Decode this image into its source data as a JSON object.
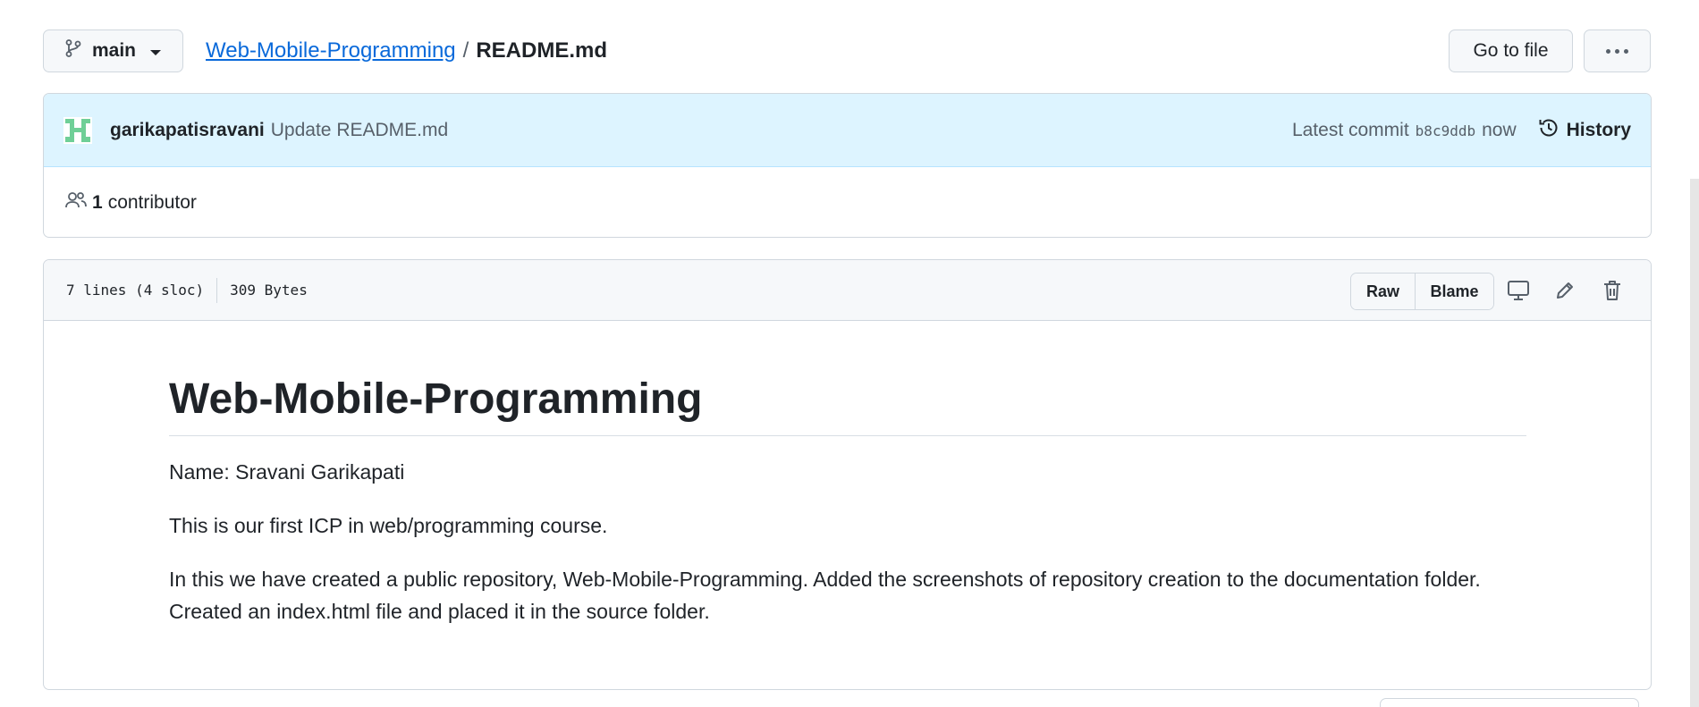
{
  "toolbar": {
    "branch_label": "main",
    "repo_link": "Web-Mobile-Programming",
    "separator": "/",
    "file_name": "README.md",
    "go_to_file": "Go to file"
  },
  "commit": {
    "author": "garikapatisravani",
    "message": "Update README.md",
    "latest_label": "Latest commit",
    "sha": "b8c9ddb",
    "time": "now",
    "history_label": "History"
  },
  "contributors": {
    "count": "1",
    "label": "contributor"
  },
  "file_info": {
    "lines": "7 lines (4 sloc)",
    "size": "309 Bytes",
    "raw_label": "Raw",
    "blame_label": "Blame"
  },
  "readme": {
    "heading": "Web-Mobile-Programming",
    "paragraphs": [
      "Name: Sravani Garikapati",
      "This is our first ICP in web/programming course.",
      "In this we have created a public repository, Web-Mobile-Programming. Added the screenshots of repository creation to the documentation folder. Created an index.html file and placed it in the source folder."
    ]
  },
  "icons": {
    "branch": "git-branch-icon",
    "caret": "chevron-down-icon",
    "more": "kebab-horizontal-icon",
    "history": "history-icon",
    "people": "people-icon",
    "display": "desktop-icon",
    "edit": "pencil-icon",
    "delete": "trash-icon"
  },
  "colors": {
    "link": "#0969da",
    "commit_bg": "#ddf4ff",
    "avatar": "#6fcf97",
    "border": "#d0d7de"
  }
}
